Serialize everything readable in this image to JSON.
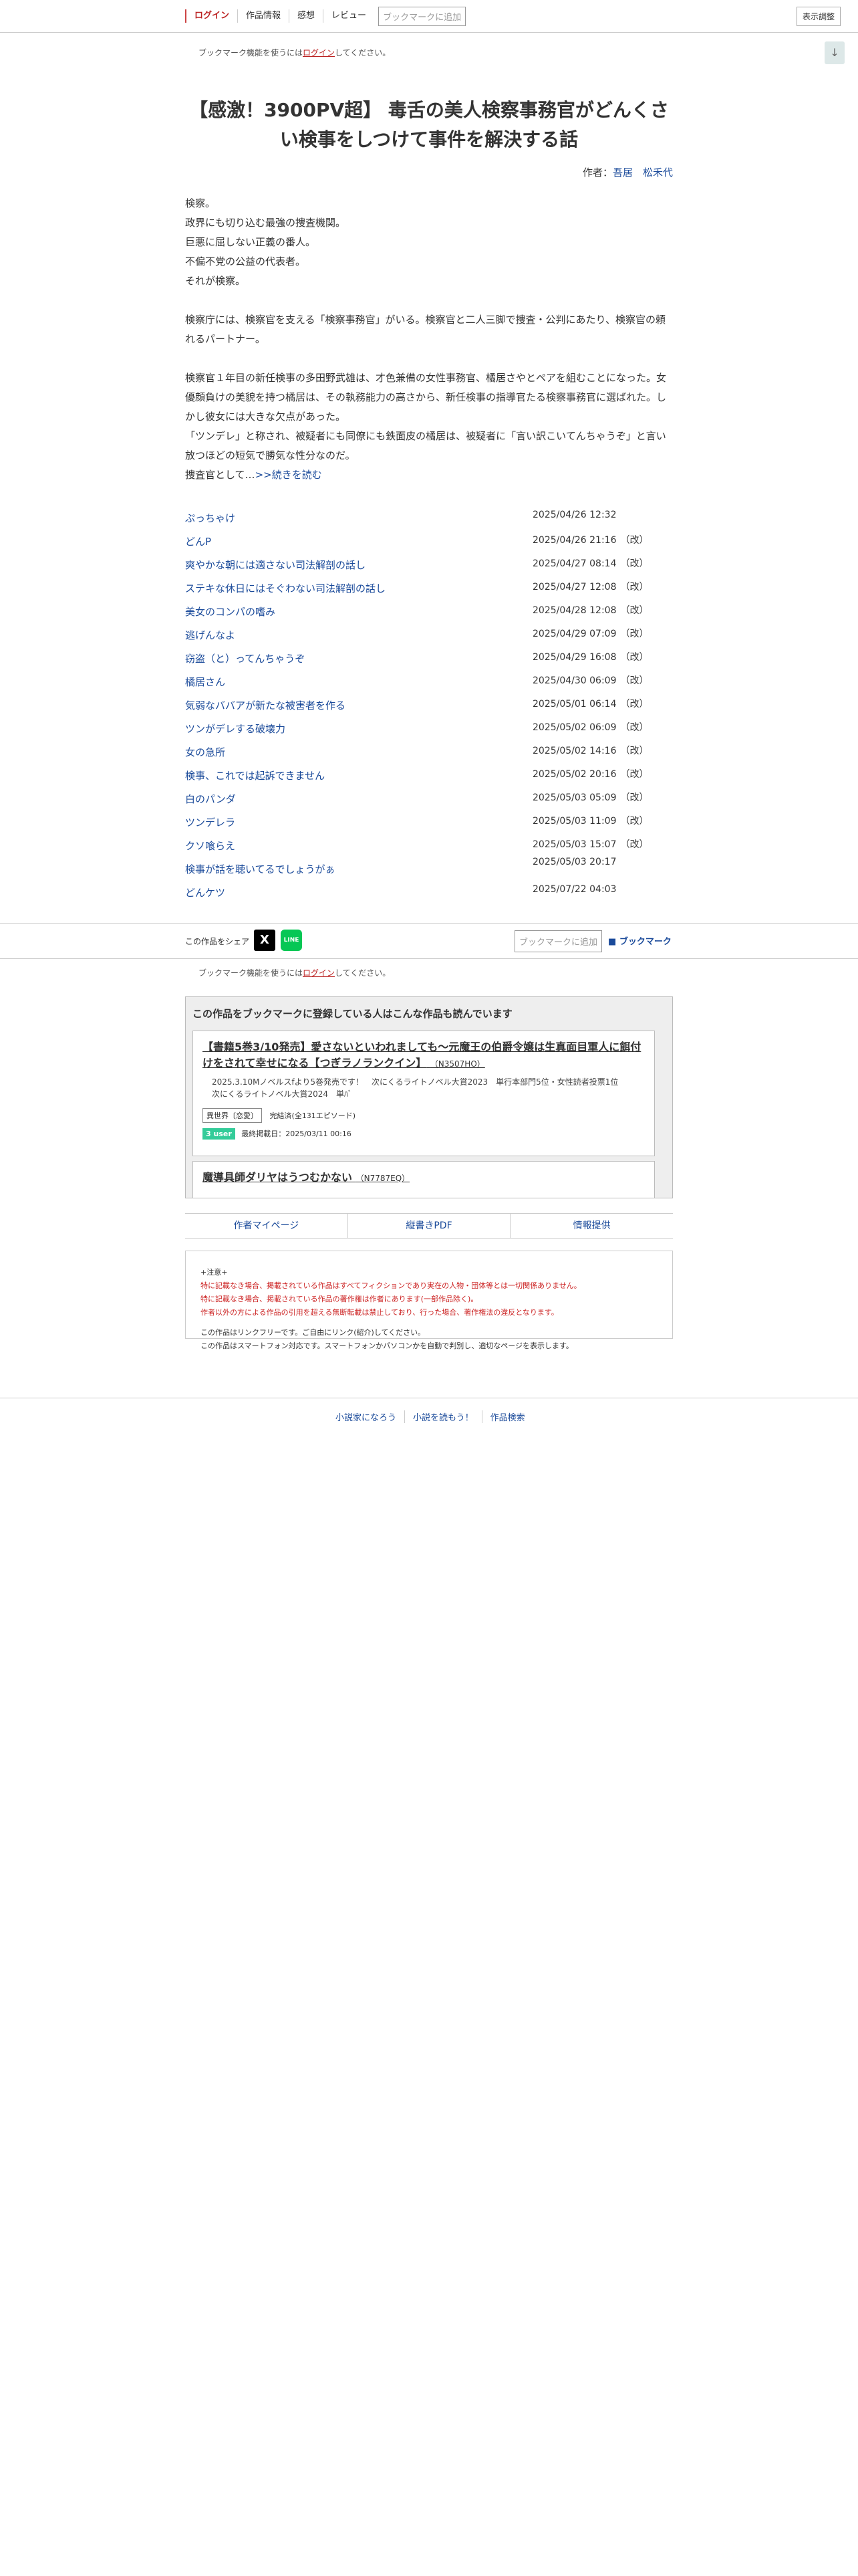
{
  "header": {
    "nav": [
      "ログイン",
      "作品情報",
      "感想",
      "レビュー"
    ],
    "bookmark_add": "ブックマークに追加",
    "display_settings": "表示調整"
  },
  "notice": {
    "prefix": "ブックマーク機能を使うには",
    "login": "ログイン",
    "suffix": "してください。"
  },
  "down_arrow": "↓",
  "novel": {
    "title": "【感激！3900PV超】 毒舌の美人検察事務官がどんくさい検事をしつけて事件を解決する話",
    "author_label": "作者：",
    "author": "吾居　松禾代",
    "synopsis": [
      "検察。",
      "政界にも切り込む最強の捜査機関。",
      "巨悪に屈しない正義の番人。",
      "不偏不党の公益の代表者。",
      "それが検察。",
      "",
      "検察庁には、検察官を支える「検察事務官」がいる。検察官と二人三脚で捜査・公判にあたり、検察官の頼れるパートナー。",
      "",
      "検察官１年目の新任検事の多田野武雄は、才色兼備の女性事務官、橘居さやとペアを組むことになった。女優顔負けの美貌を持つ橘居は、その執務能力の高さから、新任検事の指導官たる検察事務官に選ばれた。しかし彼女には大きな欠点があった。",
      "「ツンデレ」と称され、被疑者にも同僚にも鉄面皮の橘居は、被疑者に「言い訳こいてんちゃうぞ」と言い放つほどの短気で勝気な性分なのだ。",
      "捜査官として…"
    ],
    "more": ">>続きを読む"
  },
  "episodes": [
    {
      "title": "ぷっちゃけ",
      "date": "2025/04/26 12:32",
      "rev": ""
    },
    {
      "title": "どんP",
      "date": "2025/04/26 21:16",
      "rev": "（改）"
    },
    {
      "title": "爽やかな朝には適さない司法解剖の話し",
      "date": "2025/04/27 08:14",
      "rev": "（改）"
    },
    {
      "title": "ステキな休日にはそぐわない司法解剖の話し",
      "date": "2025/04/27 12:08",
      "rev": "（改）"
    },
    {
      "title": "美女のコンパの嗜み",
      "date": "2025/04/28 12:08",
      "rev": "（改）"
    },
    {
      "title": "逃げんなよ",
      "date": "2025/04/29 07:09",
      "rev": "（改）"
    },
    {
      "title": "窃盗（と）ってんちゃうぞ",
      "date": "2025/04/29 16:08",
      "rev": "（改）"
    },
    {
      "title": "橘居さん",
      "date": "2025/04/30 06:09",
      "rev": "（改）"
    },
    {
      "title": "気弱なババアが新たな被害者を作る",
      "date": "2025/05/01 06:14",
      "rev": "（改）"
    },
    {
      "title": "ツンがデレする破壊力",
      "date": "2025/05/02 06:09",
      "rev": "（改）"
    },
    {
      "title": "女の急所",
      "date": "2025/05/02 14:16",
      "rev": "（改）"
    },
    {
      "title": "検事、これでは起訴できません",
      "date": "2025/05/02 20:16",
      "rev": "（改）"
    },
    {
      "title": "白のパンダ",
      "date": "2025/05/03 05:09",
      "rev": "（改）"
    },
    {
      "title": "ツンデレラ",
      "date": "2025/05/03 11:09",
      "rev": "（改）"
    },
    {
      "title": "クソ喰らえ",
      "date": "2025/05/03 15:07",
      "rev": "（改）"
    },
    {
      "title": "検事が話を聴いてるでしょうがぁ",
      "date": "2025/05/03 20:17",
      "rev": ""
    },
    {
      "title": "どんケツ",
      "date": "2025/07/22 04:03",
      "rev": ""
    }
  ],
  "share": {
    "label": "この作品をシェア",
    "x": "X",
    "line": "LINE",
    "bookmark_add": "ブックマークに追加",
    "bookmark": "ブックマーク"
  },
  "recommend": {
    "heading": "この作品をブックマークに登録している人はこんな作品も読んでいます",
    "items": [
      {
        "title": "【書籍5巻3/10発売】愛さないといわれましても～元魔王の伯爵令嬢は生真面目軍人に餌付けをされて幸せになる【つぎラノランクイン】",
        "code": "（N3507HO）",
        "desc1": "2025.3.10Mノベルスfより5巻発売です！　次にくるライトノベル大賞2023　単行本部門5位・女性読者投票1位",
        "desc2": "次にくるライトノベル大賞2024　単ﾊﾞ",
        "genre": "異世界〔恋愛〕",
        "status": "完結済(全131エピソード)",
        "users": "3 user",
        "updated": "最終掲載日：2025/03/11 00:16"
      },
      {
        "title": "魔導具師ダリヤはうつむかない",
        "code": "（N7787EQ）"
      }
    ]
  },
  "links": [
    "作者マイページ",
    "縦書きPDF",
    "情報提供"
  ],
  "caution": {
    "head": "+注意+",
    "red1": "特に記載なき場合、掲載されている作品はすべてフィクションであり実在の人物・団体等とは一切関係ありません。",
    "red2": "特に記載なき場合、掲載されている作品の著作権は作者にあります(一部作品除く)。",
    "red3": "作者以外の方による作品の引用を超える無断転載は禁止しており、行った場合、著作権法の違反となります。",
    "black1": "この作品はリンクフリーです。ご自由にリンク(紹介)してください。",
    "black2": "この作品はスマートフォン対応です。スマートフォンかパソコンかを自動で判別し、適切なページを表示します。"
  },
  "footer": [
    "小説家になろう",
    "小説を読もう！",
    "作品検索"
  ]
}
